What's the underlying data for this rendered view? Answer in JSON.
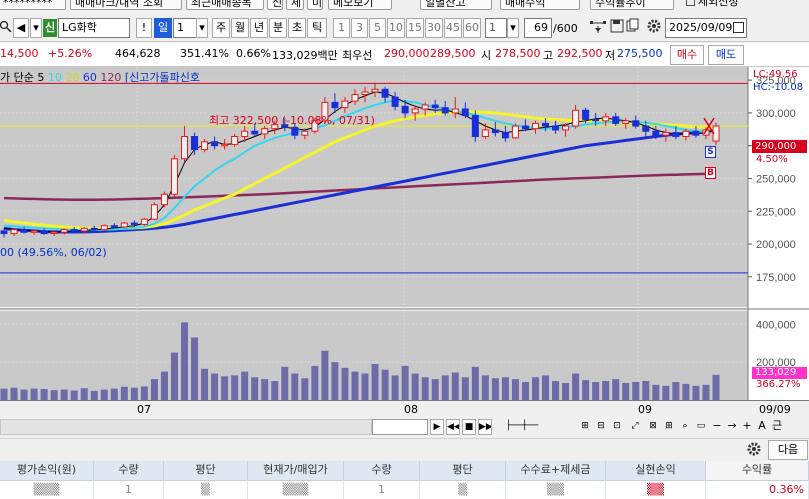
{
  "top_tabs": [
    "*********",
    "매매마크/내역 조회",
    "최근매매종목",
    "신",
    "체",
    "미",
    "메모보기",
    "일별잔고",
    "매매수익",
    "수익률추이",
    "제외선정"
  ],
  "toolbar": {
    "credit_badge": "신",
    "stock_name": "LG화학",
    "exclaim": "!",
    "period_selected": "일",
    "period_num": "1",
    "periods": [
      "주",
      "월",
      "년",
      "분",
      "초",
      "틱"
    ],
    "ticks": [
      "1",
      "3",
      "5",
      "10",
      "15",
      "30",
      "45",
      "60"
    ],
    "tick_count": "1",
    "page_counter": "69",
    "page_total": "/600",
    "date": "2025/09/09"
  },
  "quote": {
    "price": "14,500",
    "change_pct": "+5.26%",
    "volume": "464,628",
    "volume_ratio": "351.41%",
    "turnover": "0.66%",
    "amount": "133,029백만",
    "bid_label": "최우선",
    "bid1": "290,000",
    "bid2": "289,500",
    "open_label": "시",
    "open": "278,500",
    "high_label": "고",
    "high": "292,500",
    "low_label": "저",
    "low": "275,500",
    "buy_label": "매수",
    "sell_label": "매도"
  },
  "chart": {
    "legend": {
      "prefix": "가 단순",
      "ma5": "5",
      "ma10": "10",
      "ma20": "20",
      "ma60": "60",
      "ma120": "120",
      "signal": "신고가돌파신호"
    },
    "lc_label": "LC:49.56",
    "hc_label": "HC:-10.08",
    "current_price_label": "290,000",
    "current_pct_label": "4.50%",
    "max_note": "최고 322,500 (-10.08%, 07/31)",
    "min_note": "00 (49.56%, 06/02)",
    "vol_label": "133,029",
    "vol_pct_label": "366.27%",
    "s_marker": "S",
    "b_marker": "B",
    "colors": {
      "ma5": "#000000",
      "ma10": "#33d6f0",
      "ma20": "#f5f52a",
      "ma60": "#1a2fd6",
      "ma120": "#8b2a5a",
      "up": "#e8191e",
      "down": "#1a2fd6",
      "volume": "#6d6ba8"
    }
  },
  "chart_data": {
    "type": "bar",
    "price_axis": {
      "ticks": [
        "325,000",
        "300,000",
        "275,000",
        "250,000",
        "225,000",
        "200,000",
        "175,000"
      ],
      "ylim": [
        152000,
        335000
      ]
    },
    "volume_axis": {
      "ticks": [
        "400,000",
        "200,000"
      ]
    },
    "x_labels": [
      "07",
      "08",
      "09"
    ],
    "date_end": "09/09",
    "candles": [
      [
        210000,
        212000,
        205000,
        208000
      ],
      [
        208000,
        212000,
        206000,
        211000
      ],
      [
        211000,
        213000,
        208000,
        209000
      ],
      [
        209000,
        211000,
        207000,
        210000
      ],
      [
        210000,
        212000,
        207000,
        208000
      ],
      [
        208000,
        210000,
        206000,
        209000
      ],
      [
        209000,
        212000,
        207000,
        211000
      ],
      [
        211000,
        213000,
        209000,
        210000
      ],
      [
        210000,
        213000,
        208000,
        212000
      ],
      [
        212000,
        214000,
        210000,
        211000
      ],
      [
        211000,
        215000,
        210000,
        214000
      ],
      [
        214000,
        216000,
        212000,
        213000
      ],
      [
        213000,
        217000,
        212000,
        216000
      ],
      [
        216000,
        218000,
        213000,
        215000
      ],
      [
        215000,
        220000,
        214000,
        219000
      ],
      [
        219000,
        232000,
        218000,
        230000
      ],
      [
        230000,
        240000,
        228000,
        238000
      ],
      [
        238000,
        268000,
        236000,
        265000
      ],
      [
        265000,
        290000,
        262000,
        282000
      ],
      [
        282000,
        285000,
        268000,
        272000
      ],
      [
        272000,
        280000,
        270000,
        278000
      ],
      [
        278000,
        282000,
        272000,
        275000
      ],
      [
        275000,
        280000,
        272000,
        276000
      ],
      [
        276000,
        284000,
        274000,
        282000
      ],
      [
        282000,
        290000,
        278000,
        286000
      ],
      [
        286000,
        292000,
        282000,
        284000
      ],
      [
        284000,
        290000,
        280000,
        288000
      ],
      [
        288000,
        294000,
        284000,
        291000
      ],
      [
        291000,
        296000,
        286000,
        289000
      ],
      [
        289000,
        292000,
        280000,
        283000
      ],
      [
        283000,
        288000,
        280000,
        286000
      ],
      [
        286000,
        296000,
        284000,
        294000
      ],
      [
        294000,
        312000,
        292000,
        308000
      ],
      [
        308000,
        315000,
        300000,
        304000
      ],
      [
        304000,
        312000,
        300000,
        309000
      ],
      [
        309000,
        318000,
        306000,
        314000
      ],
      [
        314000,
        320000,
        308000,
        316000
      ],
      [
        316000,
        322500,
        312000,
        318000
      ],
      [
        318000,
        320000,
        308000,
        312000
      ],
      [
        312000,
        316000,
        302000,
        305000
      ],
      [
        305000,
        310000,
        296000,
        300000
      ],
      [
        300000,
        306000,
        294000,
        303000
      ],
      [
        303000,
        308000,
        298000,
        306000
      ],
      [
        306000,
        310000,
        300000,
        304000
      ],
      [
        304000,
        309000,
        298000,
        300000
      ],
      [
        300000,
        312000,
        296000,
        303000
      ],
      [
        303000,
        308000,
        296000,
        298000
      ],
      [
        298000,
        302000,
        278000,
        282000
      ],
      [
        282000,
        292000,
        280000,
        287000
      ],
      [
        287000,
        293000,
        282000,
        285000
      ],
      [
        285000,
        290000,
        278000,
        281000
      ],
      [
        281000,
        292000,
        280000,
        290000
      ],
      [
        290000,
        295000,
        286000,
        288000
      ],
      [
        288000,
        294000,
        284000,
        292000
      ],
      [
        292000,
        296000,
        286000,
        290000
      ],
      [
        290000,
        294000,
        284000,
        287000
      ],
      [
        287000,
        292000,
        282000,
        290000
      ],
      [
        290000,
        306000,
        288000,
        302000
      ],
      [
        302000,
        304000,
        292000,
        295000
      ],
      [
        295000,
        300000,
        290000,
        294000
      ],
      [
        294000,
        300000,
        290000,
        297000
      ],
      [
        297000,
        300000,
        290000,
        292000
      ],
      [
        292000,
        296000,
        288000,
        294000
      ],
      [
        294000,
        298000,
        288000,
        290000
      ],
      [
        290000,
        294000,
        282000,
        286000
      ],
      [
        286000,
        290000,
        280000,
        283000
      ],
      [
        283000,
        288000,
        278000,
        285000
      ],
      [
        285000,
        290000,
        280000,
        282000
      ],
      [
        282000,
        288000,
        279000,
        286000
      ],
      [
        286000,
        290000,
        281000,
        283000
      ],
      [
        283000,
        289000,
        280000,
        287000
      ],
      [
        278500,
        292500,
        275500,
        290000
      ]
    ],
    "volumes": [
      60,
      65,
      55,
      60,
      58,
      52,
      55,
      50,
      62,
      48,
      55,
      60,
      70,
      65,
      72,
      110,
      150,
      250,
      410,
      330,
      165,
      140,
      125,
      130,
      150,
      120,
      110,
      100,
      175,
      140,
      115,
      180,
      260,
      200,
      170,
      150,
      140,
      190,
      160,
      130,
      180,
      140,
      120,
      110,
      130,
      145,
      120,
      175,
      130,
      115,
      120,
      110,
      95,
      120,
      130,
      100,
      90,
      140,
      105,
      95,
      100,
      110,
      90,
      95,
      100,
      80,
      75,
      95,
      85,
      75,
      80,
      133
    ],
    "ma5": [
      212000,
      211000,
      210500,
      210000,
      209500,
      209200,
      209500,
      210000,
      210300,
      210800,
      211500,
      212200,
      213000,
      214000,
      216000,
      221000,
      230000,
      245000,
      262000,
      272000,
      276000,
      278000,
      276000,
      276500,
      279000,
      282000,
      285000,
      287000,
      289000,
      288000,
      287000,
      289000,
      295000,
      301000,
      306000,
      310000,
      313000,
      316000,
      315000,
      312000,
      308000,
      305000,
      303000,
      302000,
      302500,
      300000,
      298000,
      294000,
      290000,
      287000,
      285000,
      286000,
      287000,
      288000,
      289000,
      290000,
      291000,
      293000,
      294000,
      295500,
      296000,
      295000,
      294000,
      292500,
      290000,
      287000,
      285000,
      284000,
      284000,
      284000,
      285000,
      287000
    ],
    "ma10": [
      214000,
      213500,
      213000,
      212500,
      212000,
      211500,
      211000,
      210800,
      210700,
      210700,
      210900,
      211200,
      211700,
      212300,
      213200,
      215500,
      220000,
      227500,
      236000,
      244000,
      250000,
      256000,
      261000,
      265000,
      270000,
      275000,
      278000,
      281000,
      283000,
      285000,
      287000,
      288500,
      290500,
      294000,
      297500,
      300500,
      303500,
      306000,
      308000,
      309500,
      309000,
      308000,
      306000,
      304500,
      303500,
      301500,
      300000,
      298500,
      296000,
      294000,
      292000,
      290500,
      289500,
      288500,
      288000,
      288500,
      289000,
      290000,
      291000,
      292000,
      293000,
      293500,
      293500,
      293000,
      292500,
      291500,
      290000,
      288500,
      287000,
      286000,
      285500,
      285500
    ],
    "ma20": [
      218000,
      217000,
      216000,
      215000,
      214300,
      213600,
      213000,
      212500,
      212100,
      211900,
      211800,
      211800,
      212000,
      212300,
      212800,
      213800,
      215500,
      218500,
      222000,
      226000,
      229000,
      232000,
      235000,
      238000,
      242000,
      246000,
      250000,
      254000,
      258000,
      262000,
      266000,
      270000,
      274000,
      278000,
      281000,
      284000,
      287000,
      290000,
      292000,
      294000,
      295500,
      297000,
      298000,
      299000,
      300000,
      300500,
      300800,
      300800,
      300500,
      300000,
      299000,
      298000,
      297000,
      296000,
      295500,
      295000,
      294500,
      294000,
      294000,
      294000,
      293800,
      293500,
      293000,
      292500,
      292000,
      291500,
      291000,
      290500,
      290000,
      289500,
      289000,
      288500
    ],
    "ma60": [
      212000,
      211000,
      210500,
      210000,
      209500,
      209300,
      209200,
      209200,
      209300,
      209500,
      209800,
      210200,
      210600,
      211000,
      211500,
      212000,
      212800,
      213800,
      215000,
      216500,
      218000,
      219500,
      221000,
      222500,
      224000,
      225500,
      227000,
      228500,
      230000,
      231500,
      233000,
      234500,
      236000,
      237500,
      239000,
      240500,
      242000,
      243500,
      245000,
      246500,
      248000,
      249500,
      251000,
      252500,
      254000,
      255500,
      257000,
      258500,
      260000,
      261500,
      263000,
      264500,
      266000,
      267500,
      269000,
      270500,
      272000,
      273500,
      275000,
      276000,
      277000,
      278000,
      279000,
      280000,
      281000,
      282000,
      283000,
      283800,
      284400,
      285000,
      285500,
      286000
    ],
    "ma120": [
      235000,
      234800,
      234600,
      234400,
      234200,
      234000,
      233900,
      233800,
      233800,
      233800,
      233900,
      234000,
      234200,
      234400,
      234600,
      234800,
      235000,
      235300,
      235600,
      235900,
      236200,
      236500,
      236800,
      237100,
      237400,
      237700,
      238000,
      238400,
      238800,
      239200,
      239600,
      240000,
      240400,
      240800,
      241200,
      241600,
      242000,
      242400,
      242800,
      243200,
      243600,
      244000,
      244400,
      244800,
      245200,
      245600,
      246000,
      246400,
      246800,
      247200,
      247600,
      248000,
      248400,
      248800,
      249200,
      249500,
      249800,
      250100,
      250400,
      250700,
      251000,
      251300,
      251600,
      251900,
      252200,
      252500,
      252700,
      252900,
      253100,
      253300,
      253500,
      253700
    ]
  },
  "controls": {
    "zoom_label": "A",
    "extra": "근",
    "next_label": "다음"
  },
  "table": {
    "headers": [
      "평가손익(원)",
      "수량",
      "평단",
      "현재가/매입가",
      "수량",
      "평단",
      "수수료+제세금",
      "실현손익",
      "수익률"
    ],
    "row": [
      "▒▒▒",
      "1",
      "▒",
      "▒▒▒",
      "1",
      "▒",
      "▒▒",
      "▒▒",
      "0.36%"
    ]
  }
}
